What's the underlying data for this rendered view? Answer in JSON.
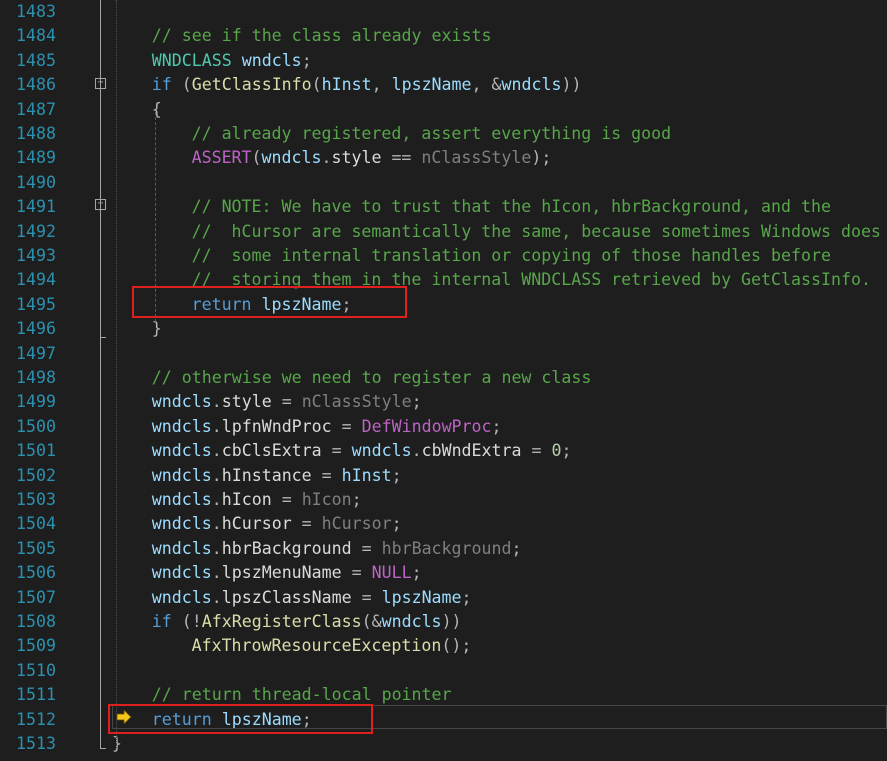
{
  "editor": {
    "colors": {
      "background": "#1e1e1e",
      "line_number": "#2b91af",
      "keyword": "#569cd6",
      "comment": "#57a64a",
      "type": "#4ec9b0",
      "function": "#dcdcaa",
      "variable": "#9cdcfe",
      "parameter": "#7f7f7f",
      "macro": "#bd63c5",
      "number": "#b5cea8",
      "annotation_box": "#e01f1f"
    },
    "execution_marker": "arrow-icon",
    "lines": [
      {
        "num": "1483",
        "indent": 0,
        "tokens": []
      },
      {
        "num": "1484",
        "indent": 4,
        "tokens": [
          {
            "t": "// see if the class already exists",
            "c": "cm"
          }
        ]
      },
      {
        "num": "1485",
        "indent": 4,
        "tokens": [
          {
            "t": "WNDCLASS",
            "c": "ty"
          },
          {
            "t": " ",
            "c": "plain"
          },
          {
            "t": "wndcls",
            "c": "var"
          },
          {
            "t": ";",
            "c": "punc"
          }
        ]
      },
      {
        "num": "1486",
        "indent": 4,
        "tokens": [
          {
            "t": "if",
            "c": "kw"
          },
          {
            "t": " (",
            "c": "punc"
          },
          {
            "t": "GetClassInfo",
            "c": "fn"
          },
          {
            "t": "(",
            "c": "punc"
          },
          {
            "t": "hInst",
            "c": "var"
          },
          {
            "t": ", ",
            "c": "punc"
          },
          {
            "t": "lpszName",
            "c": "var"
          },
          {
            "t": ", &",
            "c": "punc"
          },
          {
            "t": "wndcls",
            "c": "var"
          },
          {
            "t": "))",
            "c": "punc"
          }
        ]
      },
      {
        "num": "1487",
        "indent": 4,
        "tokens": [
          {
            "t": "{",
            "c": "punc"
          }
        ]
      },
      {
        "num": "1488",
        "indent": 8,
        "tokens": [
          {
            "t": "// already registered, assert everything is good",
            "c": "cm"
          }
        ]
      },
      {
        "num": "1489",
        "indent": 8,
        "tokens": [
          {
            "t": "ASSERT",
            "c": "mac"
          },
          {
            "t": "(",
            "c": "punc"
          },
          {
            "t": "wndcls",
            "c": "var"
          },
          {
            "t": ".",
            "c": "punc"
          },
          {
            "t": "style",
            "c": "fld"
          },
          {
            "t": " == ",
            "c": "punc"
          },
          {
            "t": "nClassStyle",
            "c": "par"
          },
          {
            "t": ");",
            "c": "punc"
          }
        ]
      },
      {
        "num": "1490",
        "indent": 0,
        "tokens": []
      },
      {
        "num": "1491",
        "indent": 8,
        "tokens": [
          {
            "t": "// NOTE: We have to trust that the hIcon, hbrBackground, and the",
            "c": "cm"
          }
        ]
      },
      {
        "num": "1492",
        "indent": 8,
        "tokens": [
          {
            "t": "//  hCursor are semantically the same, because sometimes Windows does",
            "c": "cm"
          }
        ]
      },
      {
        "num": "1493",
        "indent": 8,
        "tokens": [
          {
            "t": "//  some internal translation or copying of those handles before",
            "c": "cm"
          }
        ]
      },
      {
        "num": "1494",
        "indent": 8,
        "tokens": [
          {
            "t": "//  storing them in the internal WNDCLASS retrieved by GetClassInfo.",
            "c": "cm"
          }
        ]
      },
      {
        "num": "1495",
        "indent": 8,
        "tokens": [
          {
            "t": "return",
            "c": "kw"
          },
          {
            "t": " ",
            "c": "plain"
          },
          {
            "t": "lpszName",
            "c": "var"
          },
          {
            "t": ";",
            "c": "punc"
          }
        ]
      },
      {
        "num": "1496",
        "indent": 4,
        "tokens": [
          {
            "t": "}",
            "c": "punc"
          }
        ]
      },
      {
        "num": "1497",
        "indent": 0,
        "tokens": []
      },
      {
        "num": "1498",
        "indent": 4,
        "tokens": [
          {
            "t": "// otherwise we need to register a new class",
            "c": "cm"
          }
        ]
      },
      {
        "num": "1499",
        "indent": 4,
        "tokens": [
          {
            "t": "wndcls",
            "c": "var"
          },
          {
            "t": ".",
            "c": "punc"
          },
          {
            "t": "style",
            "c": "fld"
          },
          {
            "t": " = ",
            "c": "punc"
          },
          {
            "t": "nClassStyle",
            "c": "par"
          },
          {
            "t": ";",
            "c": "punc"
          }
        ]
      },
      {
        "num": "1500",
        "indent": 4,
        "tokens": [
          {
            "t": "wndcls",
            "c": "var"
          },
          {
            "t": ".",
            "c": "punc"
          },
          {
            "t": "lpfnWndProc",
            "c": "fld"
          },
          {
            "t": " = ",
            "c": "punc"
          },
          {
            "t": "DefWindowProc",
            "c": "mac"
          },
          {
            "t": ";",
            "c": "punc"
          }
        ]
      },
      {
        "num": "1501",
        "indent": 4,
        "tokens": [
          {
            "t": "wndcls",
            "c": "var"
          },
          {
            "t": ".",
            "c": "punc"
          },
          {
            "t": "cbClsExtra",
            "c": "fld"
          },
          {
            "t": " = ",
            "c": "punc"
          },
          {
            "t": "wndcls",
            "c": "var"
          },
          {
            "t": ".",
            "c": "punc"
          },
          {
            "t": "cbWndExtra",
            "c": "fld"
          },
          {
            "t": " = ",
            "c": "punc"
          },
          {
            "t": "0",
            "c": "num"
          },
          {
            "t": ";",
            "c": "punc"
          }
        ]
      },
      {
        "num": "1502",
        "indent": 4,
        "tokens": [
          {
            "t": "wndcls",
            "c": "var"
          },
          {
            "t": ".",
            "c": "punc"
          },
          {
            "t": "hInstance",
            "c": "fld"
          },
          {
            "t": " = ",
            "c": "punc"
          },
          {
            "t": "hInst",
            "c": "var"
          },
          {
            "t": ";",
            "c": "punc"
          }
        ]
      },
      {
        "num": "1503",
        "indent": 4,
        "tokens": [
          {
            "t": "wndcls",
            "c": "var"
          },
          {
            "t": ".",
            "c": "punc"
          },
          {
            "t": "hIcon",
            "c": "fld"
          },
          {
            "t": " = ",
            "c": "punc"
          },
          {
            "t": "hIcon",
            "c": "par"
          },
          {
            "t": ";",
            "c": "punc"
          }
        ]
      },
      {
        "num": "1504",
        "indent": 4,
        "tokens": [
          {
            "t": "wndcls",
            "c": "var"
          },
          {
            "t": ".",
            "c": "punc"
          },
          {
            "t": "hCursor",
            "c": "fld"
          },
          {
            "t": " = ",
            "c": "punc"
          },
          {
            "t": "hCursor",
            "c": "par"
          },
          {
            "t": ";",
            "c": "punc"
          }
        ]
      },
      {
        "num": "1505",
        "indent": 4,
        "tokens": [
          {
            "t": "wndcls",
            "c": "var"
          },
          {
            "t": ".",
            "c": "punc"
          },
          {
            "t": "hbrBackground",
            "c": "fld"
          },
          {
            "t": " = ",
            "c": "punc"
          },
          {
            "t": "hbrBackground",
            "c": "par"
          },
          {
            "t": ";",
            "c": "punc"
          }
        ]
      },
      {
        "num": "1506",
        "indent": 4,
        "tokens": [
          {
            "t": "wndcls",
            "c": "var"
          },
          {
            "t": ".",
            "c": "punc"
          },
          {
            "t": "lpszMenuName",
            "c": "fld"
          },
          {
            "t": " = ",
            "c": "punc"
          },
          {
            "t": "NULL",
            "c": "mac"
          },
          {
            "t": ";",
            "c": "punc"
          }
        ]
      },
      {
        "num": "1507",
        "indent": 4,
        "tokens": [
          {
            "t": "wndcls",
            "c": "var"
          },
          {
            "t": ".",
            "c": "punc"
          },
          {
            "t": "lpszClassName",
            "c": "fld"
          },
          {
            "t": " = ",
            "c": "punc"
          },
          {
            "t": "lpszName",
            "c": "var"
          },
          {
            "t": ";",
            "c": "punc"
          }
        ]
      },
      {
        "num": "1508",
        "indent": 4,
        "tokens": [
          {
            "t": "if",
            "c": "kw"
          },
          {
            "t": " (!",
            "c": "punc"
          },
          {
            "t": "AfxRegisterClass",
            "c": "fn"
          },
          {
            "t": "(&",
            "c": "punc"
          },
          {
            "t": "wndcls",
            "c": "var"
          },
          {
            "t": "))",
            "c": "punc"
          }
        ]
      },
      {
        "num": "1509",
        "indent": 8,
        "tokens": [
          {
            "t": "AfxThrowResourceException",
            "c": "fn"
          },
          {
            "t": "();",
            "c": "punc"
          }
        ]
      },
      {
        "num": "1510",
        "indent": 0,
        "tokens": []
      },
      {
        "num": "1511",
        "indent": 4,
        "tokens": [
          {
            "t": "// return thread-local pointer",
            "c": "cm"
          }
        ]
      },
      {
        "num": "1512",
        "indent": 4,
        "tokens": [
          {
            "t": "return",
            "c": "kw"
          },
          {
            "t": " ",
            "c": "plain"
          },
          {
            "t": "lpszName",
            "c": "var"
          },
          {
            "t": ";",
            "c": "punc"
          }
        ]
      },
      {
        "num": "1513",
        "indent": 0,
        "tokens": [
          {
            "t": "}",
            "c": "punc"
          }
        ]
      }
    ]
  }
}
